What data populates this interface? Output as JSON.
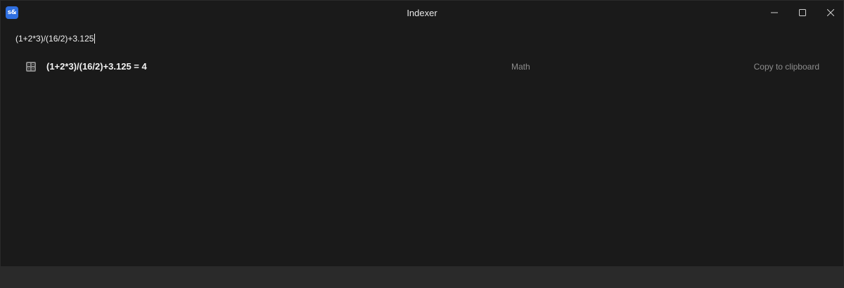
{
  "window": {
    "title": "Indexer",
    "app_icon_text": "s&"
  },
  "search": {
    "query": "(1+2*3)/(16/2)+3.125"
  },
  "results": [
    {
      "icon": "calculator-icon",
      "title": "(1+2*3)/(16/2)+3.125 = 4",
      "category": "Math",
      "action": "Copy to clipboard"
    }
  ],
  "colors": {
    "background": "#1a1a1a",
    "statusbar": "#2a2a2a",
    "accent": "#2f6fe0",
    "muted_text": "#8d8d8d"
  }
}
